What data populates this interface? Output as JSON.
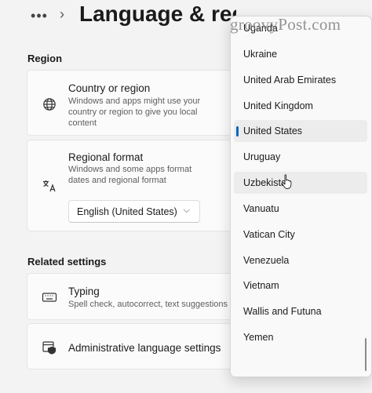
{
  "header": {
    "title": "Language & regic",
    "more_glyph": "•••",
    "chevron_glyph": "›"
  },
  "watermark": "groovyPost.com",
  "region": {
    "label": "Region",
    "country": {
      "title": "Country or region",
      "description": "Windows and apps might use your country or region to give you local content",
      "icon": "globe-icon"
    },
    "format": {
      "title": "Regional format",
      "description": "Windows and some apps format dates and regional format",
      "select_value": "English (United States)",
      "icon": "regional-format-icon"
    }
  },
  "related": {
    "label": "Related settings",
    "typing": {
      "title": "Typing",
      "description": "Spell check, autocorrect, text suggestions",
      "icon": "keyboard-icon"
    },
    "admin": {
      "title": "Administrative language settings",
      "icon": "admin-shield-icon"
    }
  },
  "dropdown": {
    "items": [
      "Uganda",
      "Ukraine",
      "United Arab Emirates",
      "United Kingdom",
      "United States",
      "Uruguay",
      "Uzbekistan",
      "Vanuatu",
      "Vatican City",
      "Venezuela",
      "Vietnam",
      "Wallis and Futuna",
      "Yemen"
    ],
    "selected": "United States",
    "hovered": "Uzbekistan",
    "accent": "#0067c0"
  }
}
